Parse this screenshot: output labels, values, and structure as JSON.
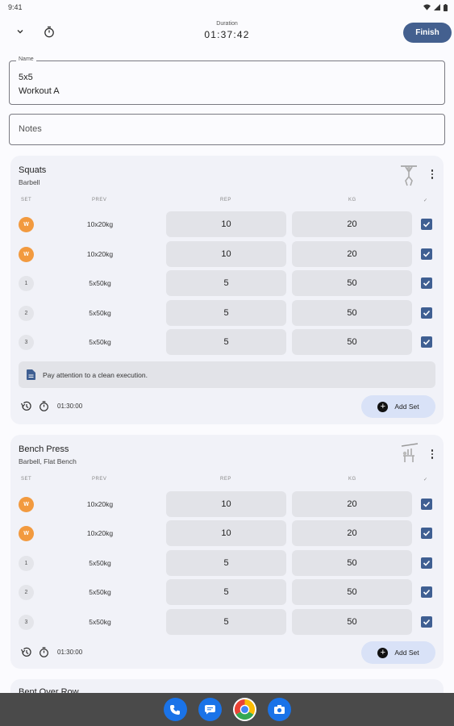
{
  "status_bar": {
    "time": "9:41"
  },
  "header": {
    "duration_label": "Duration",
    "duration_value": "01:37:42",
    "finish_label": "Finish"
  },
  "name_field": {
    "label": "Name",
    "value": "5x5\nWorkout A"
  },
  "notes_field": {
    "placeholder": "Notes"
  },
  "columns": {
    "set": "SET",
    "prev": "PREV",
    "rep": "REP",
    "kg": "KG",
    "done": "✓"
  },
  "exercises": [
    {
      "title": "Squats",
      "subtitle": "Barbell",
      "sets": [
        {
          "badge": "W",
          "type": "warmup",
          "prev": "10x20kg",
          "rep": "10",
          "kg": "20",
          "done": true
        },
        {
          "badge": "W",
          "type": "warmup",
          "prev": "10x20kg",
          "rep": "10",
          "kg": "20",
          "done": true
        },
        {
          "badge": "1",
          "type": "normal",
          "prev": "5x50kg",
          "rep": "5",
          "kg": "50",
          "done": true
        },
        {
          "badge": "2",
          "type": "normal",
          "prev": "5x50kg",
          "rep": "5",
          "kg": "50",
          "done": true
        },
        {
          "badge": "3",
          "type": "normal",
          "prev": "5x50kg",
          "rep": "5",
          "kg": "50",
          "done": true
        }
      ],
      "note": "Pay attention to a clean execution.",
      "rest_time": "01:30:00",
      "add_set_label": "Add Set"
    },
    {
      "title": "Bench Press",
      "subtitle": "Barbell, Flat Bench",
      "sets": [
        {
          "badge": "W",
          "type": "warmup",
          "prev": "10x20kg",
          "rep": "10",
          "kg": "20",
          "done": true
        },
        {
          "badge": "W",
          "type": "warmup",
          "prev": "10x20kg",
          "rep": "10",
          "kg": "20",
          "done": true
        },
        {
          "badge": "1",
          "type": "normal",
          "prev": "5x50kg",
          "rep": "5",
          "kg": "50",
          "done": true
        },
        {
          "badge": "2",
          "type": "normal",
          "prev": "5x50kg",
          "rep": "5",
          "kg": "50",
          "done": true
        },
        {
          "badge": "3",
          "type": "normal",
          "prev": "5x50kg",
          "rep": "5",
          "kg": "50",
          "done": true
        }
      ],
      "rest_time": "01:30:00",
      "add_set_label": "Add Set"
    },
    {
      "title": "Bent Over Row"
    }
  ],
  "nav_apps": [
    "phone-icon",
    "messages-icon",
    "chrome-icon",
    "camera-icon"
  ],
  "colors": {
    "primary": "#44608f",
    "warmup": "#f29a3f",
    "check": "#3f5f92",
    "add_set_bg": "#d9e2f7"
  }
}
